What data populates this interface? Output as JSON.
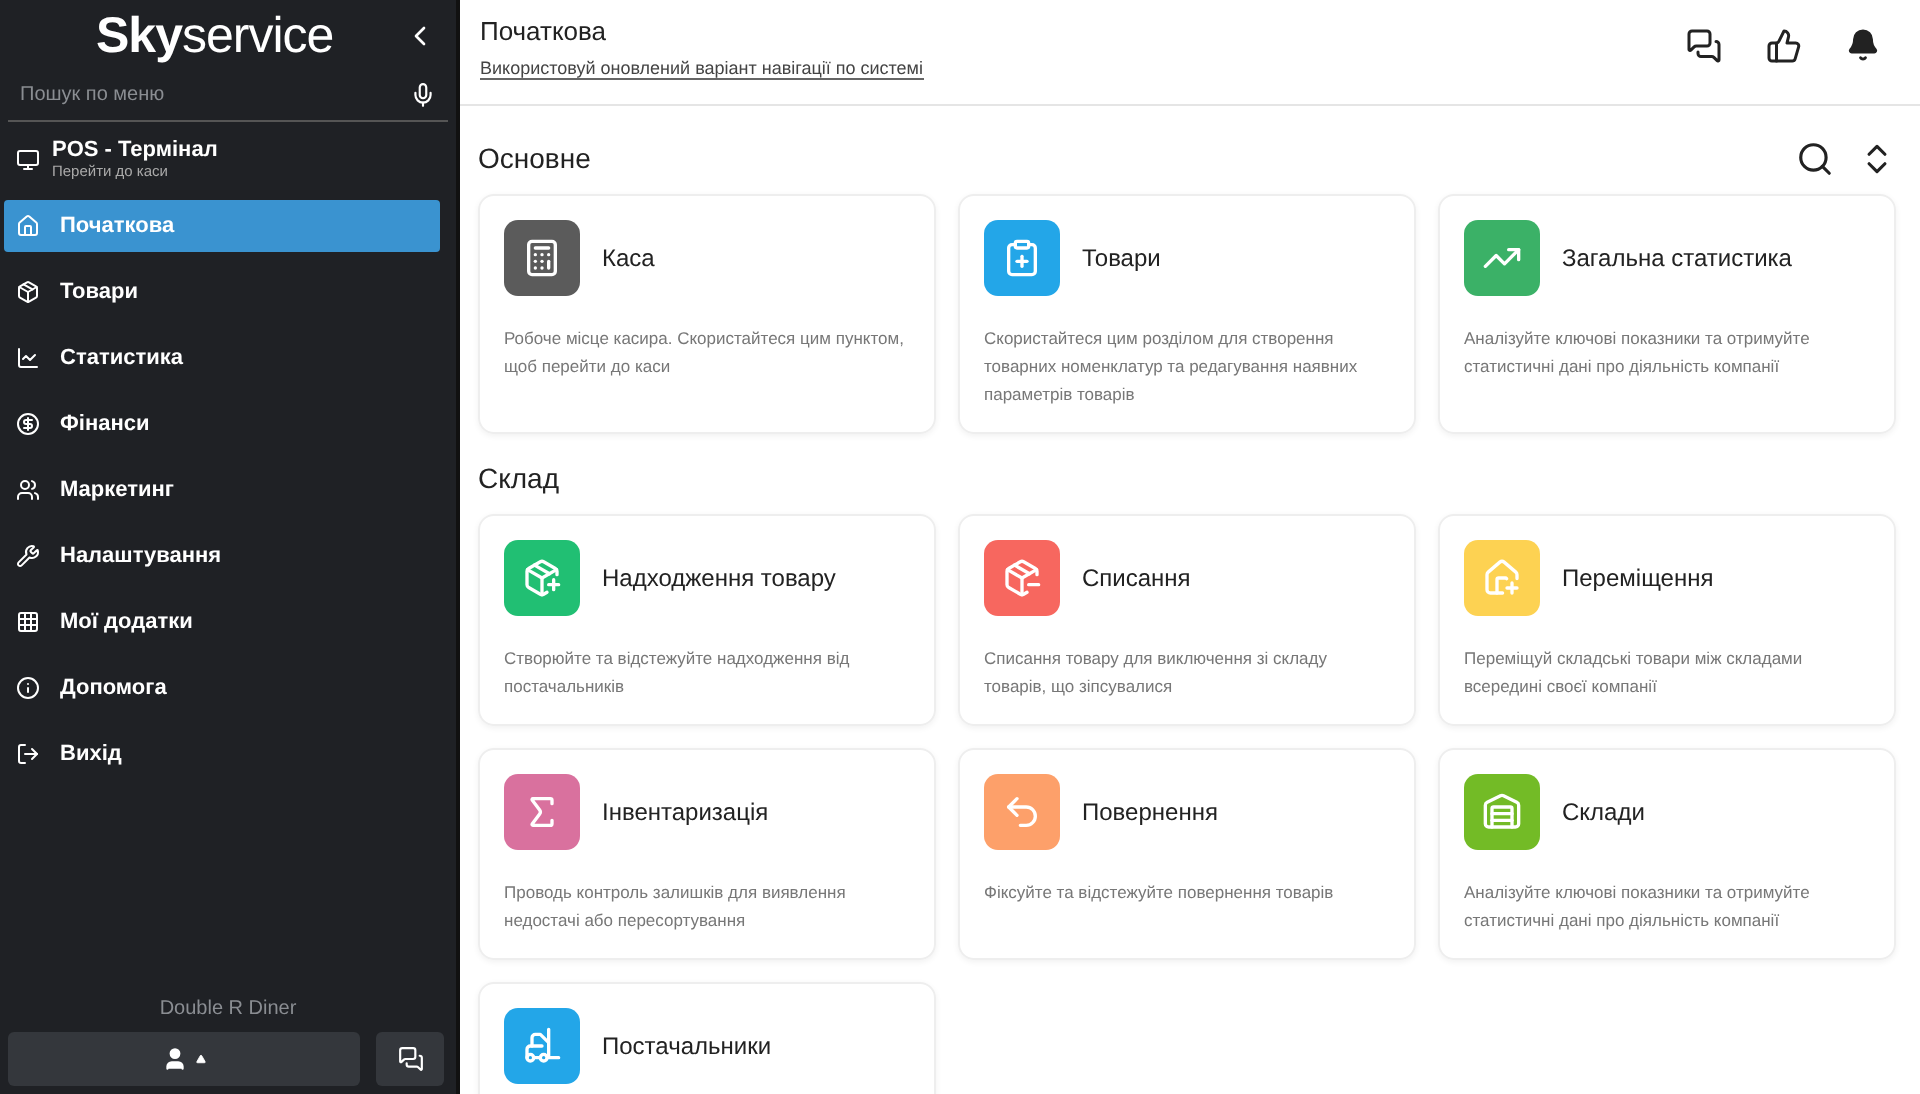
{
  "sidebar": {
    "logo_bold": "Sky",
    "logo_light": "service",
    "search": {
      "placeholder": "Пошук по меню"
    },
    "pos": {
      "title": "POS - Термінал",
      "subtitle": "Перейти до каси"
    },
    "items": [
      {
        "label": "Початкова",
        "kind": "home",
        "selected": true
      },
      {
        "label": "Товари",
        "kind": "goods",
        "selected": false
      },
      {
        "label": "Статистика",
        "kind": "stats",
        "selected": false
      },
      {
        "label": "Фінанси",
        "kind": "finance",
        "selected": false
      },
      {
        "label": "Маркетинг",
        "kind": "marketing",
        "selected": false
      },
      {
        "label": "Налаштування",
        "kind": "settings",
        "selected": false
      },
      {
        "label": "Мої додатки",
        "kind": "apps",
        "selected": false
      },
      {
        "label": "Допомога",
        "kind": "help",
        "selected": false
      },
      {
        "label": "Вихід",
        "kind": "exit",
        "selected": false
      }
    ],
    "company": "Double R Diner"
  },
  "header": {
    "title": "Початкова",
    "link": "Використовуй оновлений варіант навігації по системі"
  },
  "sections": [
    {
      "title": "Основне",
      "tools": true,
      "cards": [
        {
          "title": "Каса",
          "kind": "register",
          "color": "#5b5b5b",
          "text": "Робоче місце касира. Скористайтеся цим пунктом, щоб перейти до каси"
        },
        {
          "title": "Товари",
          "kind": "clipboard",
          "color": "#23a6e8",
          "text": "Скористайтеся цим розділом для створення товарних номенклатур та редагування наявних параметрів товарів"
        },
        {
          "title": "Загальна статистика",
          "kind": "chart",
          "color": "#3bb167",
          "text": "Аналізуйте ключові показники та отримуйте статистичні дані про діяльність компанії"
        }
      ]
    },
    {
      "title": "Склад",
      "tools": false,
      "cards": [
        {
          "title": "Надходження товару",
          "kind": "box-in",
          "color": "#21bf73",
          "text": "Створюйте та відстежуйте надходження від постачальників"
        },
        {
          "title": "Списання",
          "kind": "box-out",
          "color": "#f7675f",
          "text": "Списання товару для виключення зі складу товарів, що зіпсувалися"
        },
        {
          "title": "Переміщення",
          "kind": "move",
          "color": "#fdd252",
          "text": "Переміщуй складські товари між складами всередині своєї компанії"
        },
        {
          "title": "Інвентаризація",
          "kind": "sigma",
          "color": "#d9719e",
          "text": "Проводь контроль залишків для виявлення недостачі або пересортування"
        },
        {
          "title": "Повернення",
          "kind": "return",
          "color": "#fda06a",
          "text": "Фіксуйте та відстежуйте повернення товарів"
        },
        {
          "title": "Склади",
          "kind": "warehouse",
          "color": "#73bb26",
          "text": "Аналізуйте ключові показники та отримуйте статистичні дані про діяльність компанії"
        },
        {
          "title": "Постачальники",
          "kind": "forklift",
          "color": "#23a6e8"
        }
      ]
    }
  ]
}
